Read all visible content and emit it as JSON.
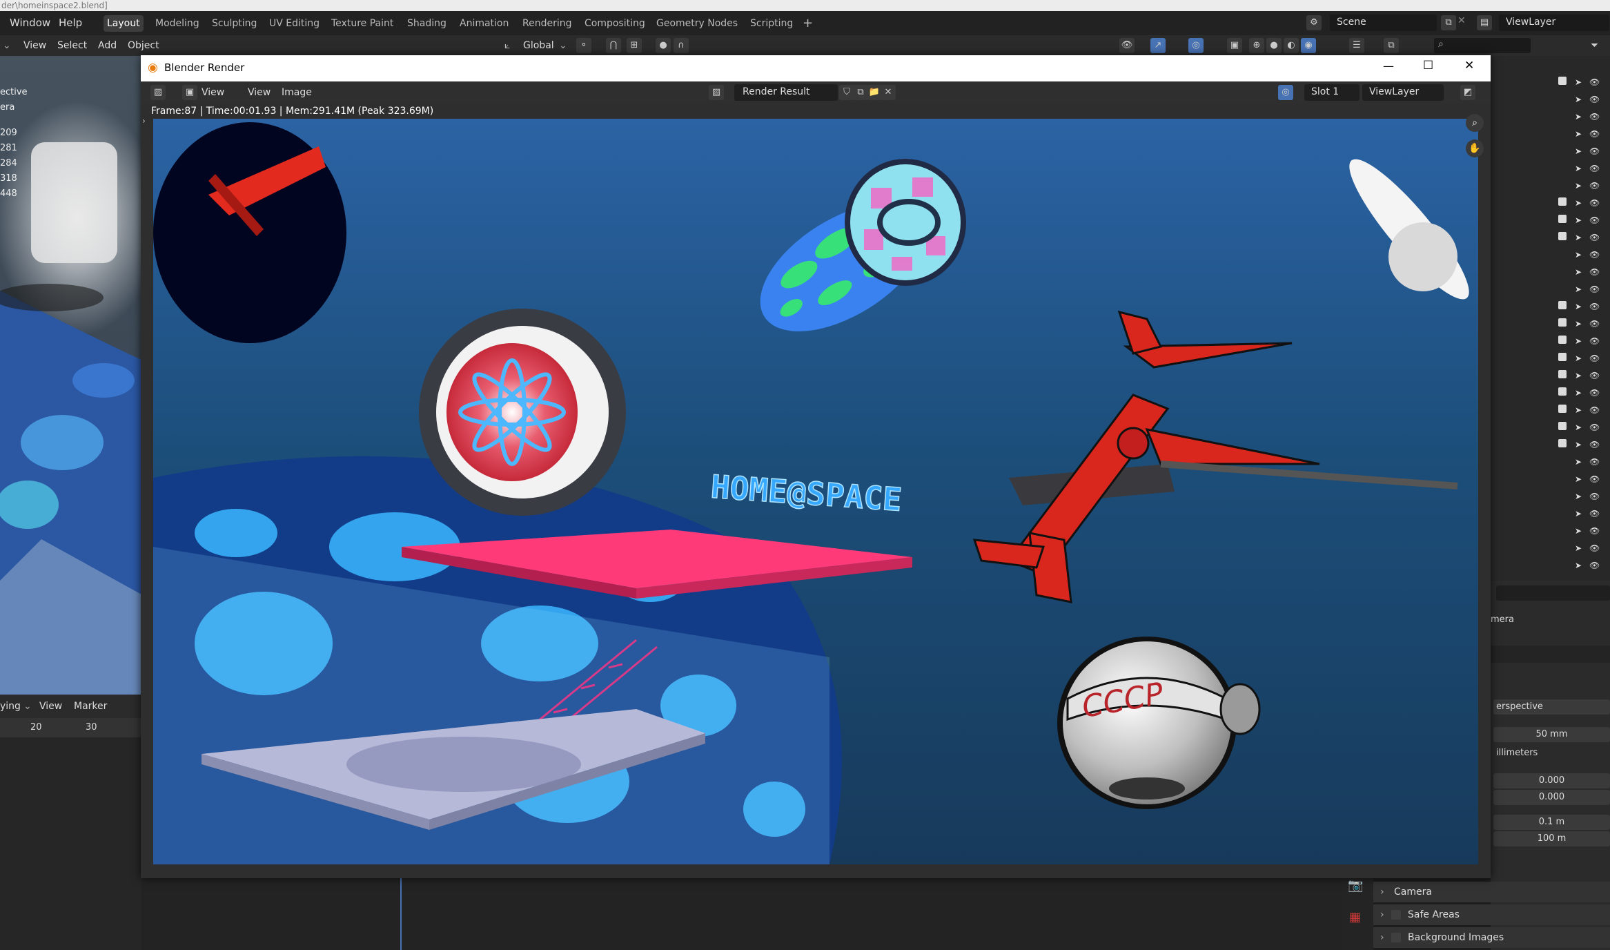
{
  "os_title": "der\\homeinspace2.blend]",
  "menubar": {
    "items": [
      "Window",
      "Help"
    ],
    "workspaces": [
      {
        "label": "Layout",
        "active": true
      },
      {
        "label": "Modeling"
      },
      {
        "label": "Sculpting"
      },
      {
        "label": "UV Editing"
      },
      {
        "label": "Texture Paint"
      },
      {
        "label": "Shading"
      },
      {
        "label": "Animation"
      },
      {
        "label": "Rendering"
      },
      {
        "label": "Compositing"
      },
      {
        "label": "Geometry Nodes"
      },
      {
        "label": "Scripting"
      }
    ],
    "add_tab_label": "+",
    "scene": "Scene",
    "view_layer": "ViewLayer"
  },
  "viewport_header": {
    "menus": [
      "View",
      "Select",
      "Add",
      "Object"
    ],
    "transform_orientation": "Global"
  },
  "left_viewport": {
    "perspective_label": "ective",
    "camera_label": "era",
    "stats": [
      "209",
      "281",
      "284",
      "318",
      "448"
    ]
  },
  "timeline": {
    "mode_label": "ying",
    "menus": [
      "View",
      "Marker"
    ],
    "ticks": [
      "20",
      "30"
    ]
  },
  "render_window": {
    "title": "Blender Render",
    "menus": [
      "View",
      "View",
      "Image"
    ],
    "image_name": "Render Result",
    "slot": "Slot 1",
    "view_layer": "ViewLayer",
    "frame_info": "Frame:87 | Time:00:01.93 | Mem:291.41M (Peak 323.69M)",
    "controls": {
      "minimize": "—",
      "maximize": "☐",
      "close": "✕"
    },
    "scene_text": "HOME@SPACE",
    "helmet_text": "CCCP"
  },
  "properties": {
    "camera_label": "mera",
    "type_value": "erspective",
    "focal_length": "50 mm",
    "lens_unit": "illimeters",
    "shift_x": "0.000",
    "shift_y": "0.000",
    "clip_start": "0.1 m",
    "clip_end": "100 m",
    "panels": [
      "Camera",
      "Safe Areas",
      "Background Images"
    ]
  },
  "colors": {
    "accent": "#4772b3",
    "render_bg": "#1c4e7a",
    "ship_red": "#d9271e",
    "platform_pink": "#ff3a78"
  }
}
